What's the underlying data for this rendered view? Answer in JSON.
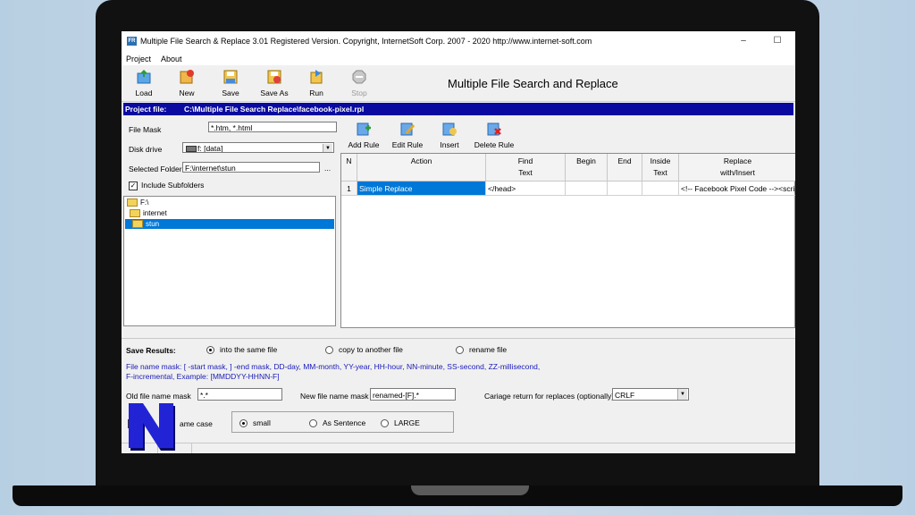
{
  "window": {
    "title": "Multiple File Search & Replace 3.01    Registered Version.  Copyright,  InternetSoft Corp.  2007 - 2020   http://www.internet-soft.com",
    "icon_text": "FR",
    "minimize": "–",
    "maximize": "☐"
  },
  "menu": [
    "Project",
    "About"
  ],
  "toolbar": {
    "buttons": [
      {
        "label": "Load",
        "icon": "load-icon"
      },
      {
        "label": "New",
        "icon": "new-icon"
      },
      {
        "label": "Save",
        "icon": "save-icon"
      },
      {
        "label": "Save As",
        "icon": "save-as-icon"
      },
      {
        "label": "Run",
        "icon": "run-icon"
      },
      {
        "label": "Stop",
        "icon": "stop-icon"
      }
    ],
    "heading": "Multiple File Search and Replace"
  },
  "project": {
    "label": "Project file:",
    "path": "C:\\Multiple File Search Replace\\facebook-pixel.rpl"
  },
  "left": {
    "file_mask_label": "File Mask",
    "file_mask_value": "*.htm, *.html",
    "disk_drive_label": "Disk drive",
    "disk_drive_value": "f: [data]",
    "selected_folder_label": "Selected Folder",
    "selected_folder_value": "F:\\internet\\stun",
    "browse": "...",
    "include_subfolders_label": "Include Subfolders",
    "include_subfolders_checked": "✓",
    "tree": [
      "F:\\",
      "internet",
      "stun"
    ]
  },
  "rules": {
    "buttons": [
      "Add Rule",
      "Edit Rule",
      "Insert",
      "Delete Rule"
    ],
    "columns": [
      "N",
      "Action",
      "Find\nText",
      "Begin",
      "End",
      "Inside\nText",
      "Replace\nwith/Insert"
    ],
    "rows": [
      {
        "n": "1",
        "action": "Simple Replace",
        "find": "</head>",
        "begin": "",
        "end": "",
        "inside": "",
        "replace": "<!-- Facebook Pixel Code --><script>"
      }
    ]
  },
  "save_results": {
    "label": "Save Results:",
    "options": [
      "into the same file",
      "copy to another file",
      "rename file"
    ],
    "selected": "into the same file",
    "hint_line1": "File name mask:  [ -start mask,      ] -end mask,  DD-day,  MM-month, YY-year, HH-hour, NN-minute, SS-second,  ZZ-millisecond,",
    "hint_line2": "F-incremental, Example:  [MMDDYY-HHNN-F]",
    "old_mask_label": "Old file name mask",
    "old_mask_value": "*.*",
    "new_mask_label": "New file name mask",
    "new_mask_value": "renamed-[F].*",
    "carriage_label": "Cariage return for replaces (optionally)",
    "carriage_value": "CRLF",
    "case_label": "ame case",
    "case_options": [
      "small",
      "As Sentence",
      "LARGE"
    ],
    "case_selected": "small"
  },
  "colors": {
    "project_bar": "#0a0aa0",
    "selection": "#0078d7",
    "hint_text": "#1a1ab8",
    "logo": "#2323d6"
  }
}
